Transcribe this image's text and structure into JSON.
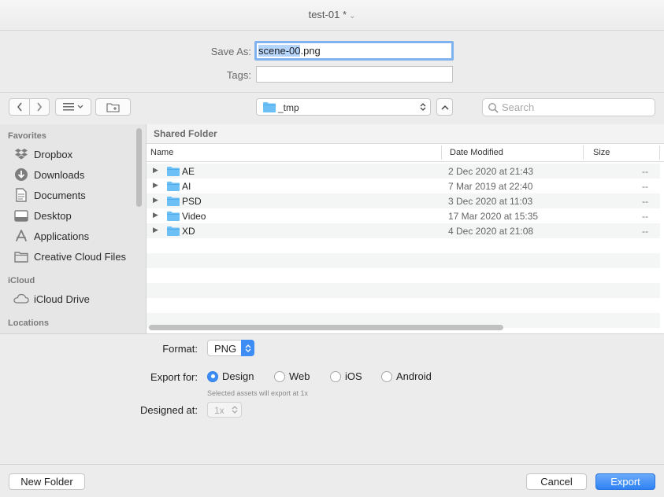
{
  "window": {
    "title": "test-01 *"
  },
  "save": {
    "save_as_label": "Save As:",
    "filename_selected": "scene-00",
    "filename_ext": ".png",
    "tags_label": "Tags:",
    "tags_value": ""
  },
  "toolbar": {
    "location": "_tmp",
    "search_placeholder": "Search"
  },
  "sidebar": {
    "sections": [
      {
        "heading": "Favorites",
        "items": [
          "Dropbox",
          "Downloads",
          "Documents",
          "Desktop",
          "Applications",
          "Creative Cloud Files"
        ]
      },
      {
        "heading": "iCloud",
        "items": [
          "iCloud Drive"
        ]
      },
      {
        "heading": "Locations",
        "items": []
      }
    ],
    "icons": [
      "dropbox-icon",
      "downloads-icon",
      "documents-icon",
      "desktop-icon",
      "applications-icon",
      "folder-icon",
      "icloud-icon"
    ]
  },
  "browser": {
    "path": "Shared Folder",
    "columns": {
      "name": "Name",
      "date": "Date Modified",
      "size": "Size"
    },
    "rows": [
      {
        "name": "AE",
        "date": "2 Dec 2020 at 21:43",
        "size": "--"
      },
      {
        "name": "AI",
        "date": "7 Mar 2019 at 22:40",
        "size": "--"
      },
      {
        "name": "PSD",
        "date": "3 Dec 2020 at 11:03",
        "size": "--"
      },
      {
        "name": "Video",
        "date": "17 Mar 2020 at 15:35",
        "size": "--"
      },
      {
        "name": "XD",
        "date": "4 Dec 2020 at 21:08",
        "size": "--"
      }
    ]
  },
  "options": {
    "format_label": "Format:",
    "format_value": "PNG",
    "export_for_label": "Export for:",
    "export_for_options": [
      "Design",
      "Web",
      "iOS",
      "Android"
    ],
    "export_for_selected": "Design",
    "export_note": "Selected assets will export at 1x",
    "designed_at_label": "Designed at:",
    "designed_at_value": "1x"
  },
  "buttons": {
    "new_folder": "New Folder",
    "cancel": "Cancel",
    "export": "Export"
  },
  "colors": {
    "accent": "#2f82f4",
    "selection": "#b5d5fd",
    "folder": "#6cc0f5"
  }
}
